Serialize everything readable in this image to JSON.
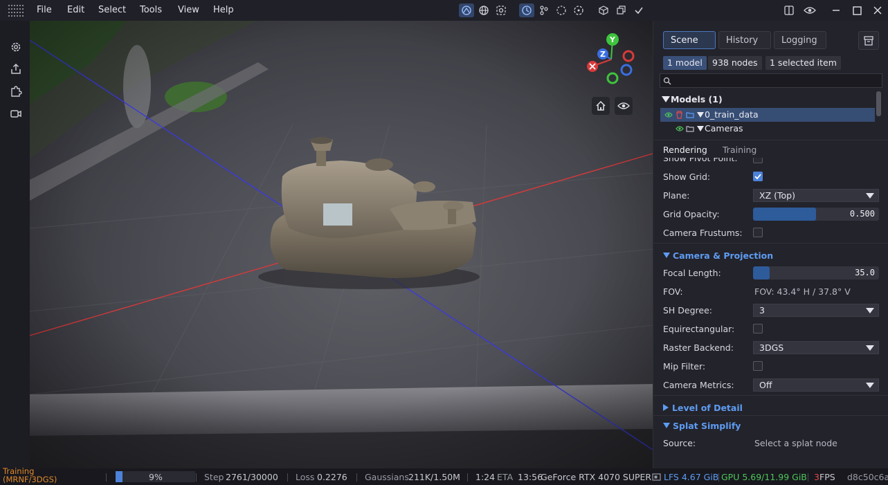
{
  "menu": {
    "items": [
      "File",
      "Edit",
      "Select",
      "Tools",
      "View",
      "Help"
    ]
  },
  "toolbar": {
    "icons": [
      "orbit-icon",
      "globe-icon",
      "target-icon",
      "clock-icon",
      "nodes-icon",
      "lasso-icon",
      "crosshair-icon",
      "cube-icon",
      "layers-icon",
      "check-icon"
    ]
  },
  "window_controls": [
    "split-view-icon",
    "eye-icon",
    "minimize-icon",
    "maximize-icon",
    "close-icon"
  ],
  "left_tools": [
    "gear-icon",
    "export-icon",
    "plugin-icon",
    "camera-icon"
  ],
  "gizmo": {
    "y": "Y",
    "z": "Z"
  },
  "panel": {
    "tabs": [
      "Scene",
      "History",
      "Logging"
    ],
    "chips": [
      "1 model",
      "938 nodes",
      "1 selected item"
    ],
    "search_placeholder": "",
    "models_header": "Models (1)",
    "tree": [
      {
        "label": "0_train_data"
      },
      {
        "label": "Cameras"
      }
    ]
  },
  "props": {
    "tabs": [
      "Rendering",
      "Training"
    ],
    "show_pivot_label": "Show Pivot Point:",
    "show_grid_label": "Show Grid:",
    "plane_label": "Plane:",
    "plane_value": "XZ (Top)",
    "grid_opacity_label": "Grid Opacity:",
    "grid_opacity_value": "0.500",
    "grid_opacity": 0.5,
    "camera_frustums_label": "Camera Frustums:",
    "section_camera": "Camera & Projection",
    "focal_length_label": "Focal Length:",
    "focal_length_value": "35.0",
    "fov_label": "FOV:",
    "fov_value": "FOV: 43.4° H / 37.8° V",
    "sh_degree_label": "SH Degree:",
    "sh_degree_value": "3",
    "equirect_label": "Equirectangular:",
    "raster_label": "Raster Backend:",
    "raster_value": "3DGS",
    "mip_label": "Mip Filter:",
    "camera_metrics_label": "Camera Metrics:",
    "camera_metrics_value": "Off",
    "section_lod": "Level of Detail",
    "section_splat": "Splat Simplify",
    "source_label": "Source:",
    "source_value": "Select a splat node"
  },
  "status": {
    "mode_line1": "Training",
    "mode_line2": "(MRNF/3DGS)",
    "progress_pct": "9%",
    "progress": 0.09,
    "step_label": "Step",
    "step_value": "2761/30000",
    "loss_label": "Loss",
    "loss_value": "0.2276",
    "gaussians_label": "Gaussians",
    "gaussians_value": "211K/1.50M",
    "time_value": "1:24",
    "eta_label": "ETA",
    "eta_value": "13:56",
    "gpu_name": "GeForce RTX 4070 SUPER",
    "lfs": "LFS 4.67 GiB",
    "gpu_mem": "GPU 5.69/11.99 GiB",
    "fps_value": "3",
    "fps_label": "FPS",
    "hash": "d8c50c6a"
  },
  "colors": {
    "accent": "#4c82d8",
    "section": "#5e9cf2",
    "x_axis": "#d83a3a",
    "y_axis": "#3ec43e",
    "z_axis": "#3a6ee0"
  }
}
